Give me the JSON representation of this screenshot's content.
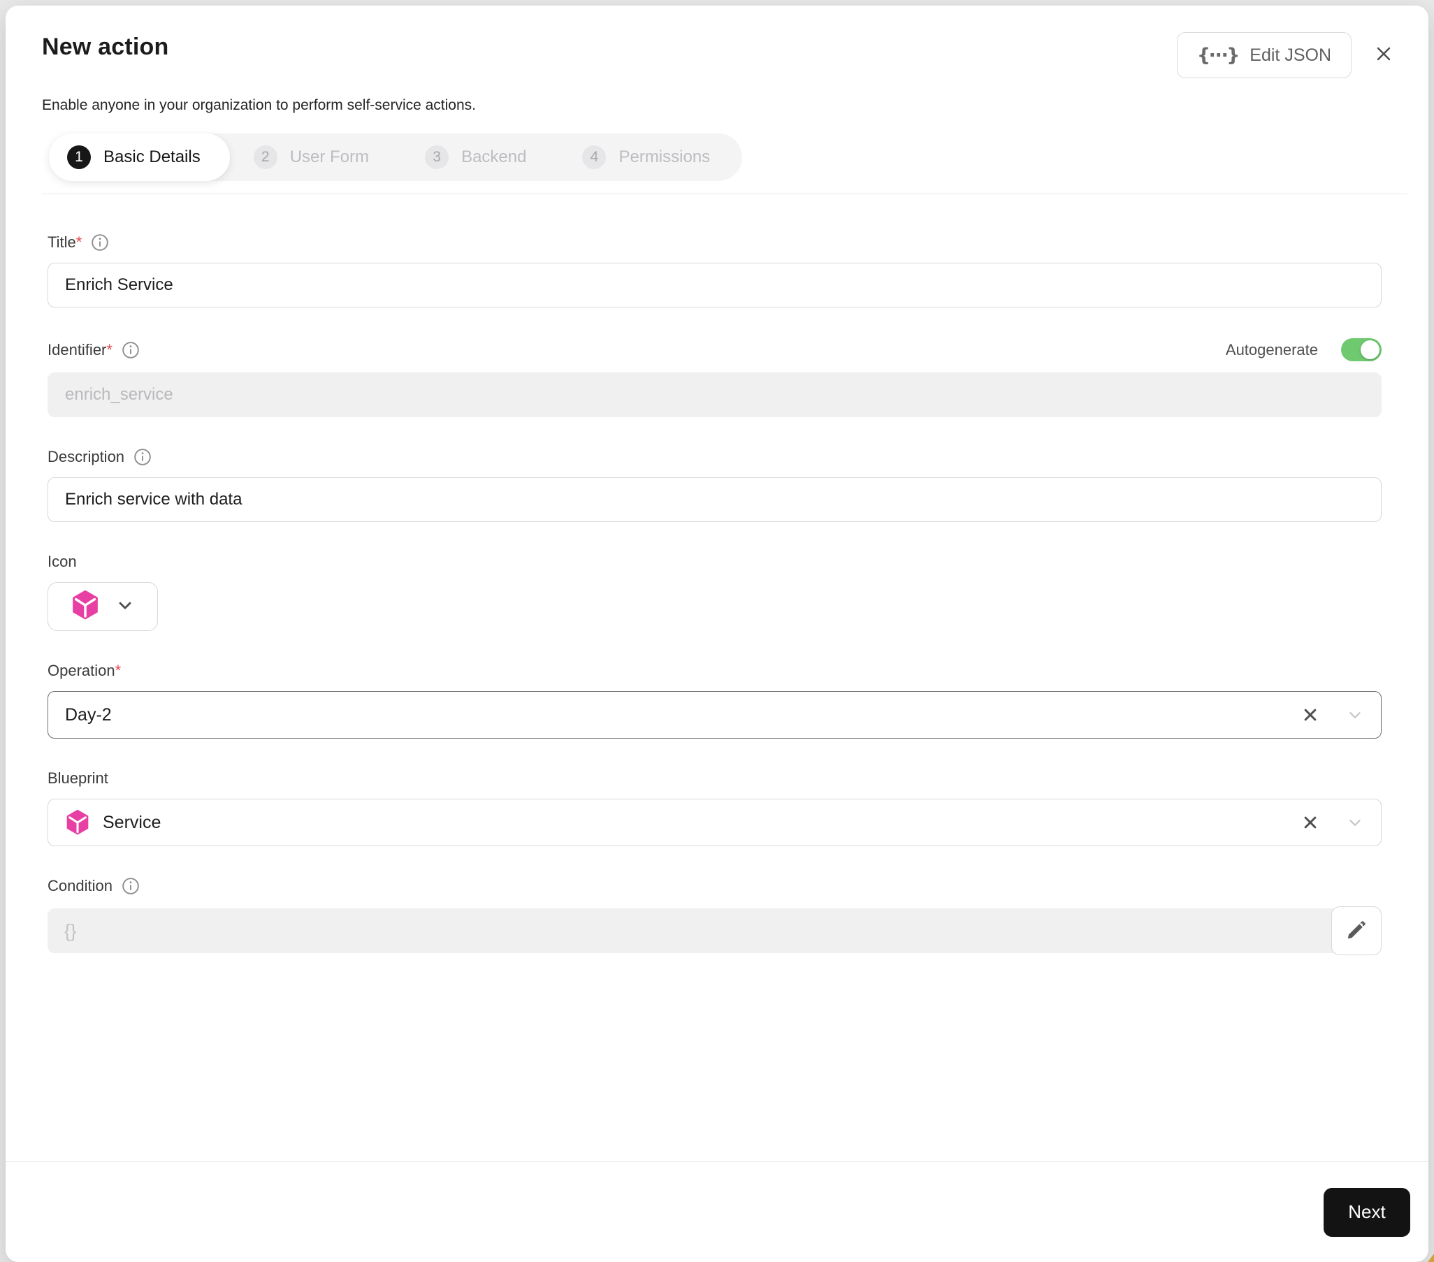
{
  "header": {
    "title": "New action",
    "subtitle": "Enable anyone in your organization to perform self-service actions.",
    "edit_json_label": "Edit JSON",
    "braces_glyph": "{⋯}"
  },
  "stepper": {
    "steps": [
      {
        "number": "1",
        "label": "Basic Details",
        "active": true
      },
      {
        "number": "2",
        "label": "User Form",
        "active": false
      },
      {
        "number": "3",
        "label": "Backend",
        "active": false
      },
      {
        "number": "4",
        "label": "Permissions",
        "active": false
      }
    ]
  },
  "form": {
    "title": {
      "label": "Title",
      "required": "*",
      "value": "Enrich Service"
    },
    "identifier": {
      "label": "Identifier",
      "required": "*",
      "value": "enrich_service",
      "autogenerate_label": "Autogenerate",
      "autogenerate_on": true
    },
    "description": {
      "label": "Description",
      "value": "Enrich service with data"
    },
    "icon": {
      "label": "Icon",
      "selected_icon": "service-cube-icon"
    },
    "operation": {
      "label": "Operation",
      "required": "*",
      "value": "Day-2"
    },
    "blueprint": {
      "label": "Blueprint",
      "value": "Service",
      "value_icon": "service-cube-icon"
    },
    "condition": {
      "label": "Condition",
      "placeholder": "{}"
    }
  },
  "footer": {
    "next_label": "Next"
  },
  "colors": {
    "accent_pink": "#e83fa4",
    "toggle_green": "#6fc96f",
    "button_black": "#131313",
    "required_red": "#e5484d"
  }
}
